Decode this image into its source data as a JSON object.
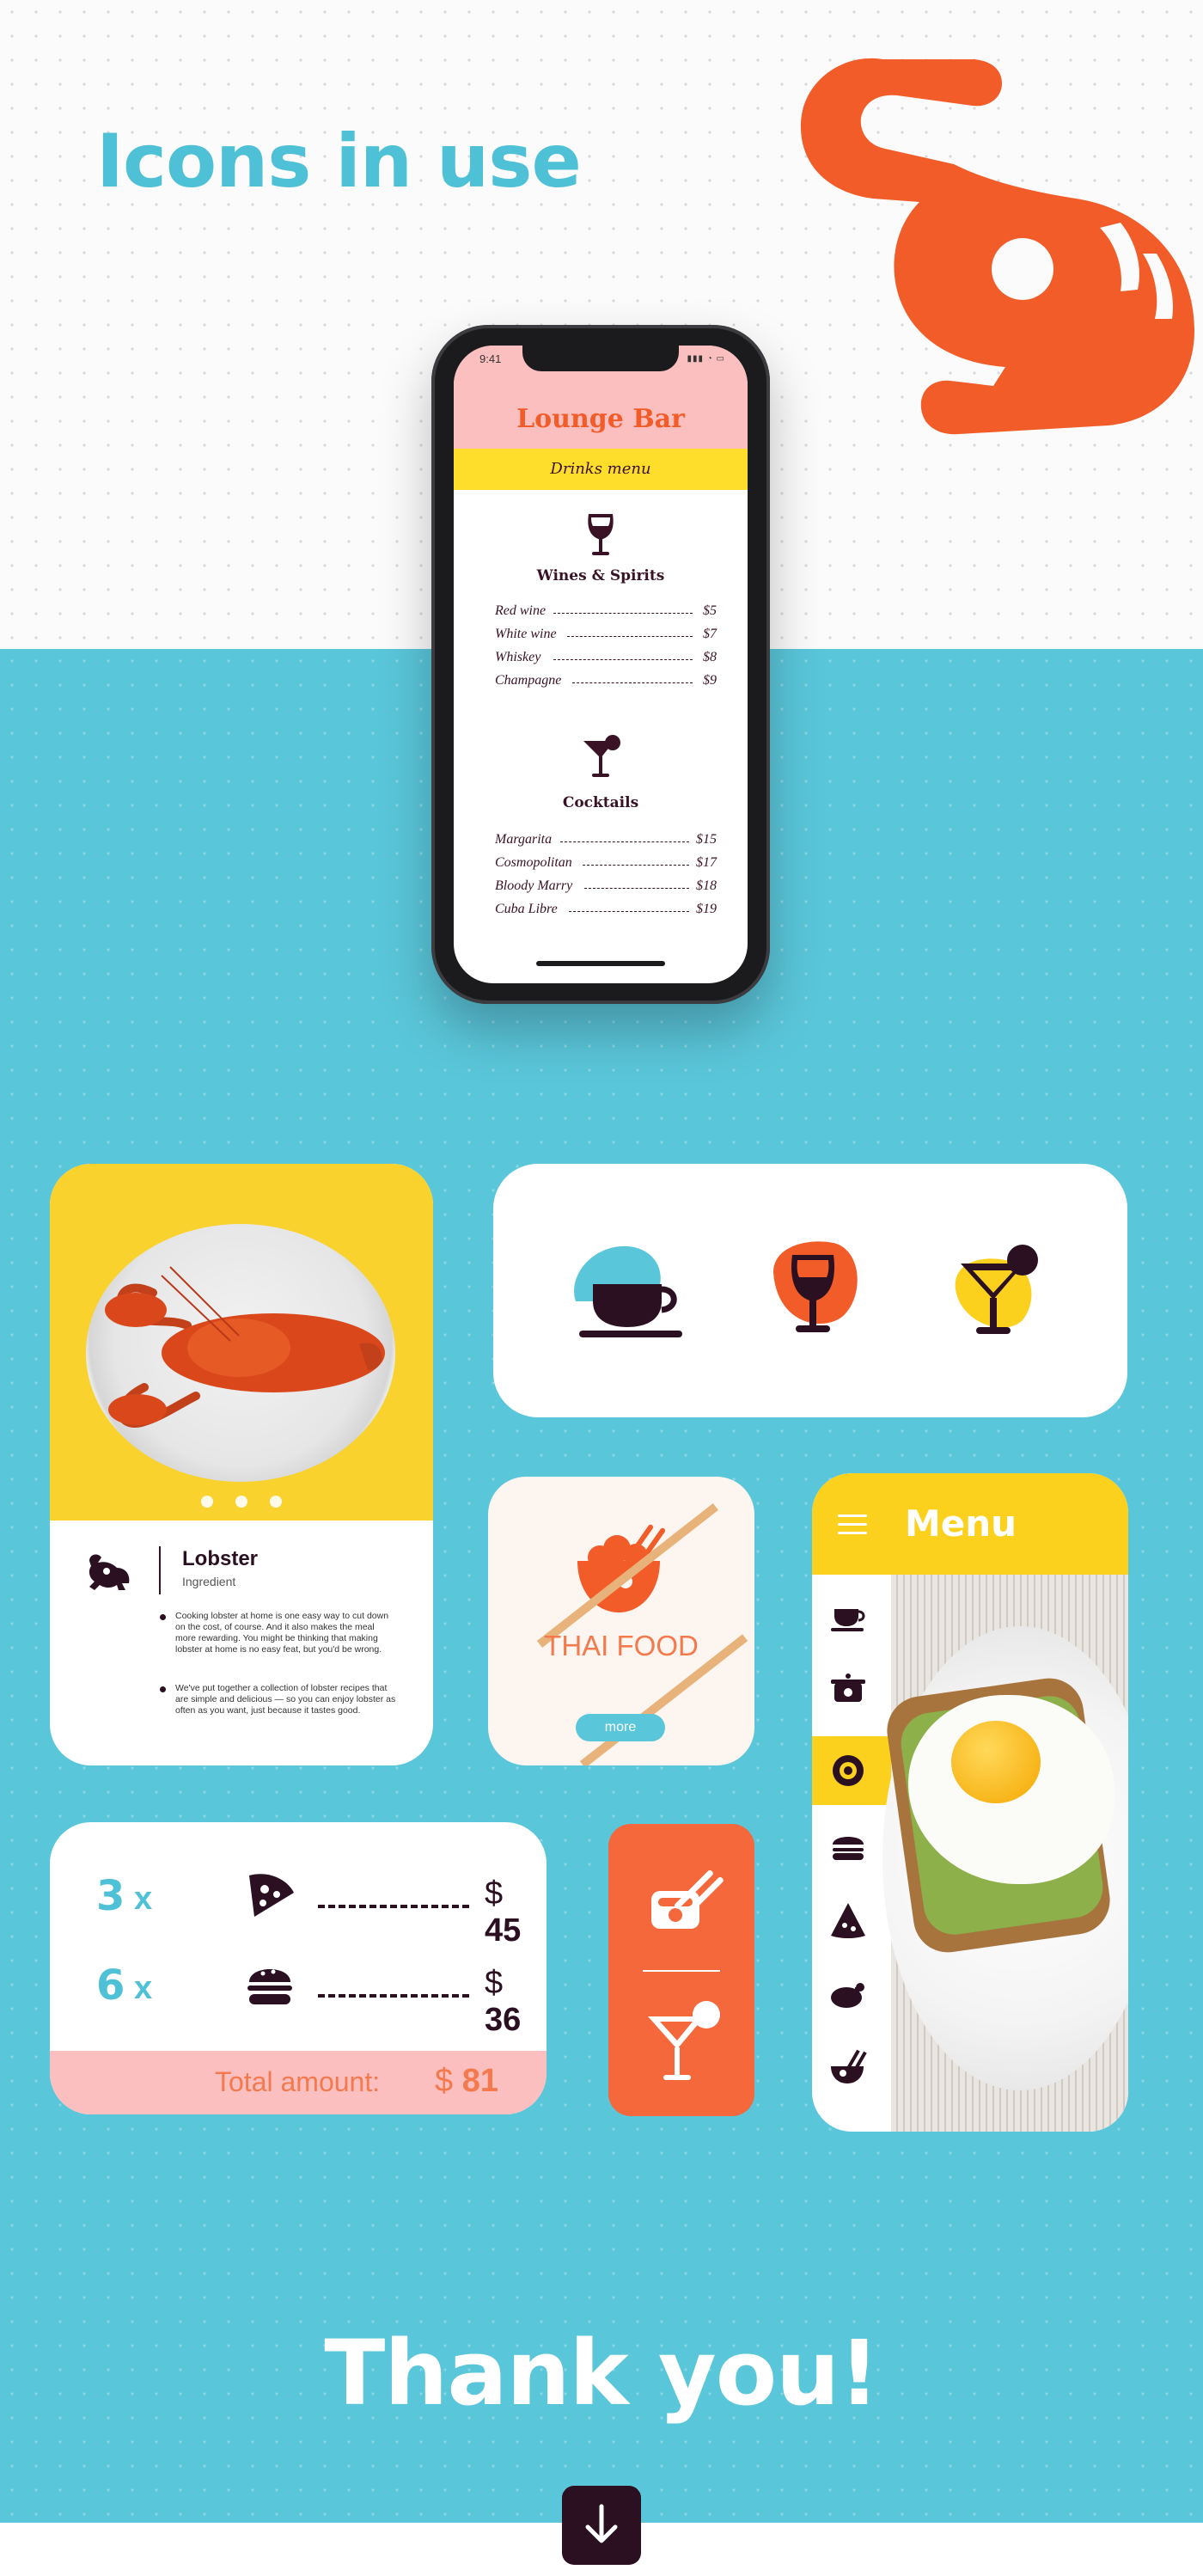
{
  "heading": "Icons in use",
  "colors": {
    "accent_blue": "#5ac6da",
    "brand_orange": "#f25c29",
    "yellow": "#fbd11e",
    "pink": "#fbbfc0",
    "dark": "#2a1020"
  },
  "phone": {
    "status_time": "9:41",
    "title": "Lounge Bar",
    "subtitle": "Drinks menu",
    "sections": [
      {
        "title": "Wines & Spirits",
        "icon": "wine-glass-icon",
        "items": [
          {
            "name": "Red wine",
            "price": "$5"
          },
          {
            "name": "White wine",
            "price": "$7"
          },
          {
            "name": "Whiskey",
            "price": "$8"
          },
          {
            "name": "Champagne",
            "price": "$9"
          }
        ]
      },
      {
        "title": "Cocktails",
        "icon": "cocktail-icon",
        "items": [
          {
            "name": "Margarita",
            "price": "$15"
          },
          {
            "name": "Cosmopolitan",
            "price": "$17"
          },
          {
            "name": "Bloody Marry",
            "price": "$18"
          },
          {
            "name": "Cuba Libre",
            "price": "$19"
          }
        ]
      }
    ]
  },
  "lobster_card": {
    "name": "Lobster",
    "type": "Ingredient",
    "bullets": [
      "Cooking lobster at home is one easy way to cut down on the cost, of course. And it also makes the meal more rewarding. You might be thinking that making lobster at home is no easy feat, but you'd be wrong.",
      "We've put together a collection of lobster recipes that are simple and delicious — so you can enjoy lobster as often as you want, just because it tastes good."
    ]
  },
  "icons_card": {
    "icons": [
      "coffee-cup-icon",
      "wine-glass-icon",
      "cocktail-icon"
    ]
  },
  "thai_card": {
    "title": "THAI FOOD",
    "button": "more"
  },
  "menu_card": {
    "title": "Menu",
    "side_icons": [
      "coffee-cup-icon",
      "pot-icon",
      "fried-egg-icon",
      "burger-icon",
      "pizza-icon",
      "roast-chicken-icon",
      "noodles-icon"
    ],
    "active_index": 2
  },
  "order_card": {
    "rows": [
      {
        "qty": "3",
        "x": "x",
        "icon": "pizza-icon",
        "currency": "$",
        "price": "45"
      },
      {
        "qty": "6",
        "x": "x",
        "icon": "burger-icon",
        "currency": "$",
        "price": "36"
      }
    ],
    "total_label": "Total amount:",
    "total_currency": "$",
    "total_value": "81"
  },
  "orange_card": {
    "icons": [
      "sushi-icon",
      "cocktail-icon"
    ]
  },
  "footer": {
    "thanks": "Thank you!"
  }
}
